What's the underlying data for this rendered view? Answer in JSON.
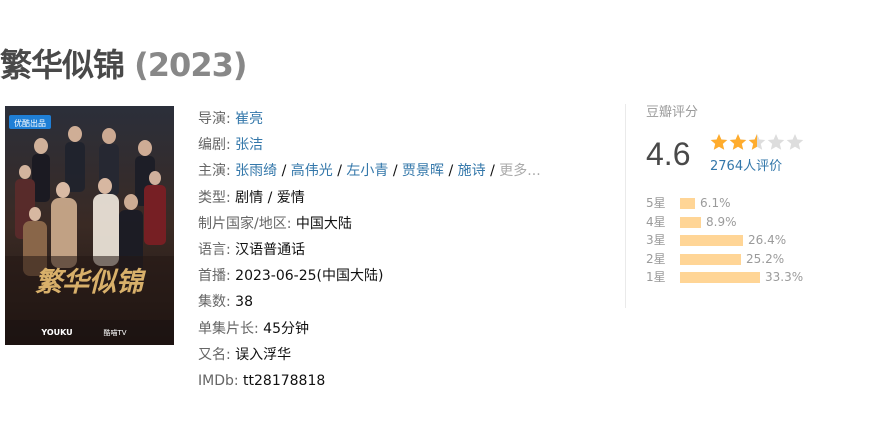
{
  "title": {
    "name": "繁华似锦",
    "year": "(2023)"
  },
  "poster": {
    "badge": "优酷出品",
    "calligraphy": "繁华似锦",
    "logos": [
      "YOUKU",
      "酷喵TV"
    ]
  },
  "info": {
    "director_label": "导演:",
    "director": "崔亮",
    "writer_label": "编剧:",
    "writer": "张洁",
    "cast_label": "主演:",
    "cast": [
      "张雨绮",
      "高伟光",
      "左小青",
      "贾景晖",
      "施诗"
    ],
    "cast_sep": " / ",
    "cast_more": "更多...",
    "genre_label": "类型:",
    "genre": "剧情 / 爱情",
    "country_label": "制片国家/地区:",
    "country": "中国大陆",
    "language_label": "语言:",
    "language": "汉语普通话",
    "premiere_label": "首播:",
    "premiere": "2023-06-25(中国大陆)",
    "episodes_label": "集数:",
    "episodes": "38",
    "runtime_label": "单集片长:",
    "runtime": "45分钟",
    "aka_label": "又名:",
    "aka": "误入浮华",
    "imdb_label": "IMDb:",
    "imdb": "tt28178818"
  },
  "rating": {
    "title": "豆瓣评分",
    "score": "4.6",
    "stars_value": 2.5,
    "stars_max": 5,
    "votes": "2764人评价",
    "star_color": "#ffac2d",
    "bar_color": "#ffd596",
    "distribution": [
      {
        "label": "5星",
        "percent": "6.1%",
        "value": 6.1
      },
      {
        "label": "4星",
        "percent": "8.9%",
        "value": 8.9
      },
      {
        "label": "3星",
        "percent": "26.4%",
        "value": 26.4
      },
      {
        "label": "2星",
        "percent": "25.2%",
        "value": 25.2
      },
      {
        "label": "1星",
        "percent": "33.3%",
        "value": 33.3
      }
    ]
  }
}
